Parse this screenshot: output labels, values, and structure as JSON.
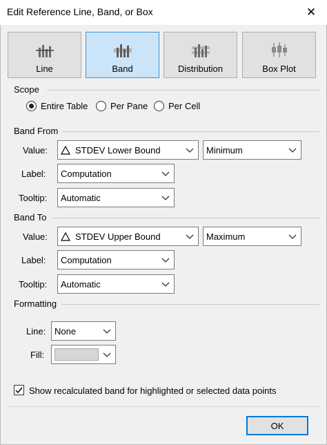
{
  "window": {
    "title": "Edit Reference Line, Band, or Box",
    "close_glyph": "✕"
  },
  "tabs": [
    {
      "label": "Line",
      "icon": "reference-line-icon",
      "selected": false
    },
    {
      "label": "Band",
      "icon": "reference-band-icon",
      "selected": true
    },
    {
      "label": "Distribution",
      "icon": "distribution-icon",
      "selected": false
    },
    {
      "label": "Box Plot",
      "icon": "box-plot-icon",
      "selected": false
    }
  ],
  "scope": {
    "heading": "Scope",
    "options": [
      {
        "label": "Entire Table",
        "selected": true
      },
      {
        "label": "Per Pane",
        "selected": false
      },
      {
        "label": "Per Cell",
        "selected": false
      }
    ]
  },
  "band_from": {
    "heading": "Band From",
    "value_label": "Value:",
    "value": "STDEV Lower Bound",
    "aggregation": "Minimum",
    "label_label": "Label:",
    "label_value": "Computation",
    "tooltip_label": "Tooltip:",
    "tooltip_value": "Automatic"
  },
  "band_to": {
    "heading": "Band To",
    "value_label": "Value:",
    "value": "STDEV Upper Bound",
    "aggregation": "Maximum",
    "label_label": "Label:",
    "label_value": "Computation",
    "tooltip_label": "Tooltip:",
    "tooltip_value": "Automatic"
  },
  "formatting": {
    "heading": "Formatting",
    "line_label": "Line:",
    "line_value": "None",
    "fill_label": "Fill:",
    "fill_color": "#d6d6d6"
  },
  "recalc": {
    "label": "Show recalculated band for highlighted or selected data points",
    "checked": true
  },
  "ok_label": "OK",
  "colors": {
    "selected_tile": "#cce4f7",
    "selected_border": "#3c91d9",
    "focus": "#0078d7"
  }
}
